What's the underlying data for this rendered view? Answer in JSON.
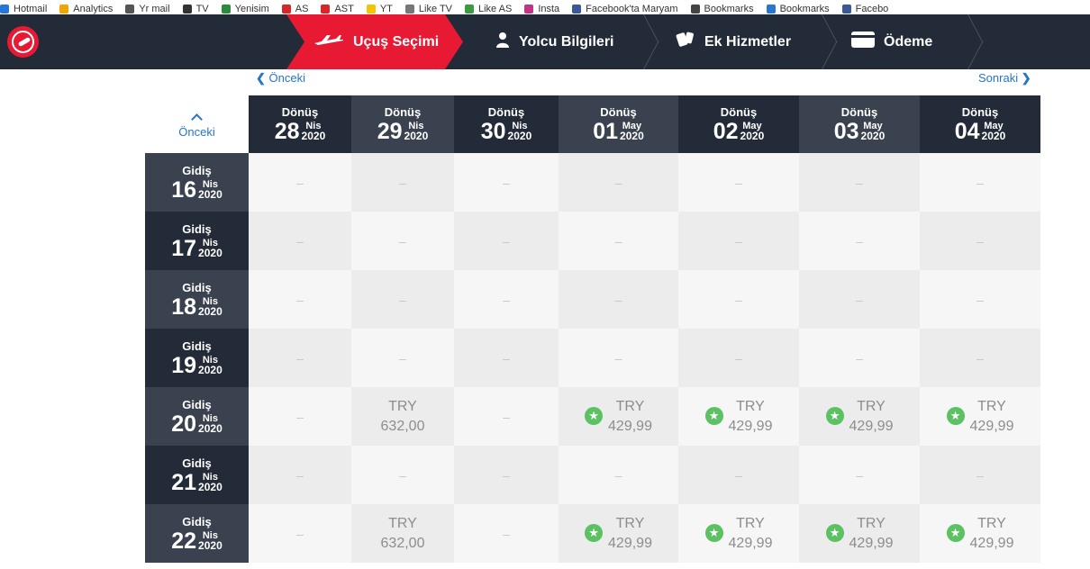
{
  "bookmarks": [
    {
      "label": "Hotmail",
      "color": "#2776d8"
    },
    {
      "label": "Analytics",
      "color": "#f4a400"
    },
    {
      "label": "Yr mail",
      "color": "#555555"
    },
    {
      "label": "TV",
      "color": "#333333"
    },
    {
      "label": "Yenisim",
      "color": "#2a8c3c"
    },
    {
      "label": "AS",
      "color": "#d62828"
    },
    {
      "label": "AST",
      "color": "#d62828"
    },
    {
      "label": "YT",
      "color": "#f4c400"
    },
    {
      "label": "Like TV",
      "color": "#777777"
    },
    {
      "label": "Like AS",
      "color": "#3a9b40"
    },
    {
      "label": "Insta",
      "color": "#c13584"
    },
    {
      "label": "Facebook'ta Maryam",
      "color": "#3b5998"
    },
    {
      "label": "Bookmarks",
      "color": "#444444"
    },
    {
      "label": "Bookmarks",
      "color": "#2776d8"
    },
    {
      "label": "Facebo",
      "color": "#3b5998"
    }
  ],
  "steps": [
    {
      "label": "Uçuş Seçimi",
      "icon": "plane-icon",
      "active": true
    },
    {
      "label": "Yolcu Bilgileri",
      "icon": "person-icon",
      "active": false
    },
    {
      "label": "Ek Hizmetler",
      "icon": "tag-icon",
      "active": false
    },
    {
      "label": "Ödeme",
      "icon": "card-icon",
      "active": false
    }
  ],
  "nav": {
    "prev": "Önceki",
    "next": "Sonraki",
    "prev_week": "Önceki"
  },
  "return_label": "Dönüş",
  "depart_label": "Gidiş",
  "return_dates": [
    {
      "day": "28",
      "month": "Nis",
      "year": "2020"
    },
    {
      "day": "29",
      "month": "Nis",
      "year": "2020"
    },
    {
      "day": "30",
      "month": "Nis",
      "year": "2020"
    },
    {
      "day": "01",
      "month": "May",
      "year": "2020"
    },
    {
      "day": "02",
      "month": "May",
      "year": "2020"
    },
    {
      "day": "03",
      "month": "May",
      "year": "2020"
    },
    {
      "day": "04",
      "month": "May",
      "year": "2020"
    }
  ],
  "depart_dates": [
    {
      "day": "16",
      "month": "Nis",
      "year": "2020"
    },
    {
      "day": "17",
      "month": "Nis",
      "year": "2020"
    },
    {
      "day": "18",
      "month": "Nis",
      "year": "2020"
    },
    {
      "day": "19",
      "month": "Nis",
      "year": "2020"
    },
    {
      "day": "20",
      "month": "Nis",
      "year": "2020"
    },
    {
      "day": "21",
      "month": "Nis",
      "year": "2020"
    },
    {
      "day": "22",
      "month": "Nis",
      "year": "2020"
    }
  ],
  "empty_mark": "–",
  "grid": [
    [
      null,
      null,
      null,
      null,
      null,
      null,
      null
    ],
    [
      null,
      null,
      null,
      null,
      null,
      null,
      null
    ],
    [
      null,
      null,
      null,
      null,
      null,
      null,
      null
    ],
    [
      null,
      null,
      null,
      null,
      null,
      null,
      null
    ],
    [
      null,
      {
        "currency": "TRY",
        "price": "632,00",
        "best": false
      },
      null,
      {
        "currency": "TRY",
        "price": "429,99",
        "best": true
      },
      {
        "currency": "TRY",
        "price": "429,99",
        "best": true
      },
      {
        "currency": "TRY",
        "price": "429,99",
        "best": true
      },
      {
        "currency": "TRY",
        "price": "429,99",
        "best": true
      }
    ],
    [
      null,
      null,
      null,
      null,
      null,
      null,
      null
    ],
    [
      null,
      {
        "currency": "TRY",
        "price": "632,00",
        "best": false
      },
      null,
      {
        "currency": "TRY",
        "price": "429,99",
        "best": true
      },
      {
        "currency": "TRY",
        "price": "429,99",
        "best": true
      },
      {
        "currency": "TRY",
        "price": "429,99",
        "best": true
      },
      {
        "currency": "TRY",
        "price": "429,99",
        "best": true
      }
    ]
  ]
}
